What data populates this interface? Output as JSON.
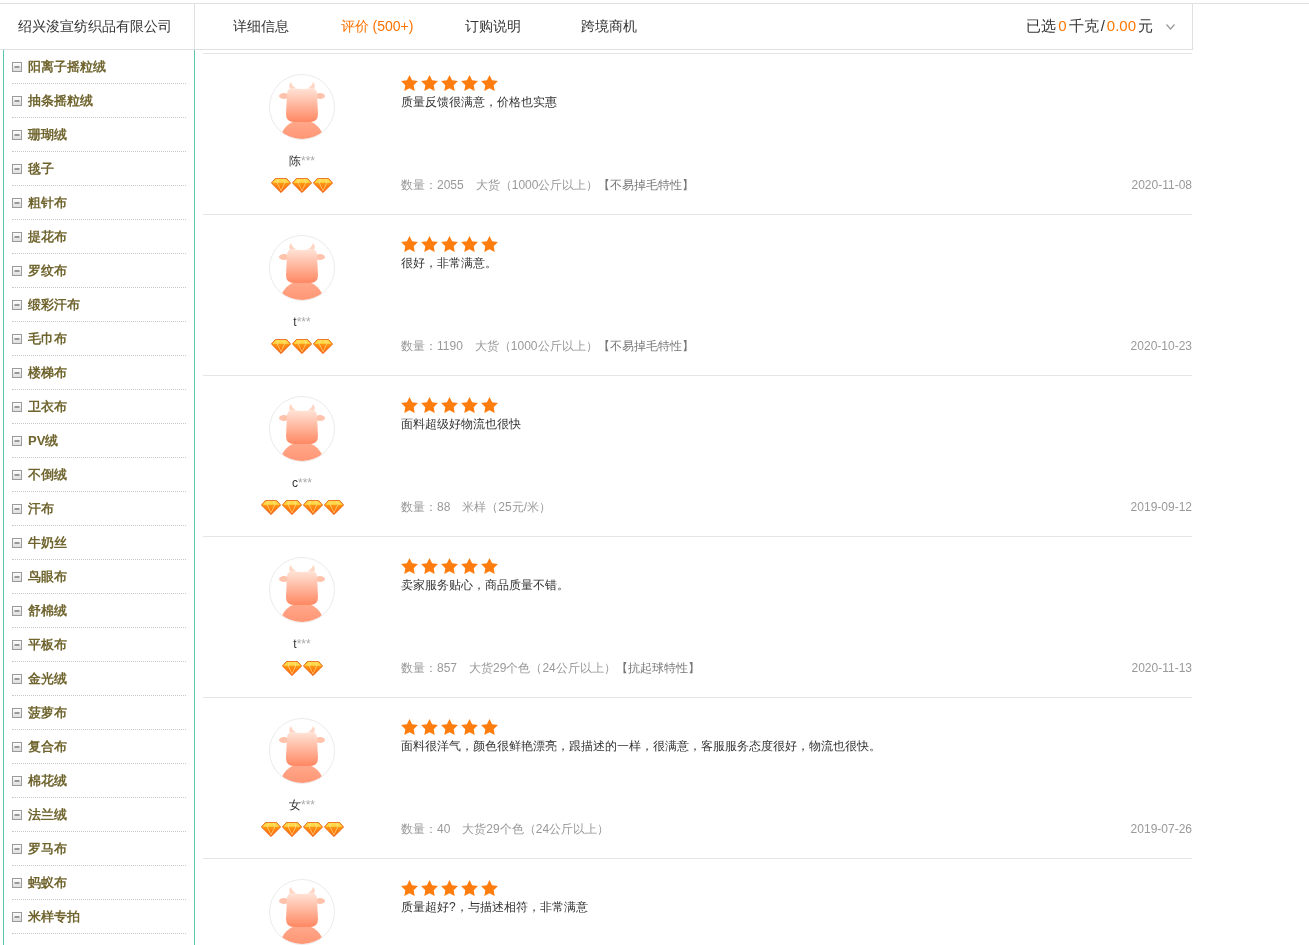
{
  "company_name": "绍兴浚宣纺织品有限公司",
  "tabs": [
    {
      "label": "详细信息",
      "selected": false
    },
    {
      "label": "评价 (500+)",
      "selected": true
    },
    {
      "label": "订购说明",
      "selected": false
    },
    {
      "label": "跨境商机",
      "selected": false
    }
  ],
  "selection_summary": [
    {
      "text": "已选",
      "kind": "label"
    },
    {
      "text": "0",
      "kind": "value"
    },
    {
      "text": "千克",
      "kind": "label"
    },
    {
      "text": "/",
      "kind": "label"
    },
    {
      "text": "0.00",
      "kind": "value"
    },
    {
      "text": "元",
      "kind": "label"
    }
  ],
  "sidebar": {
    "items": [
      {
        "label": "阳离子摇粒绒",
        "expanded": true
      },
      {
        "label": "抽条摇粒绒",
        "expanded": true
      },
      {
        "label": "珊瑚绒",
        "expanded": true
      },
      {
        "label": "毯子",
        "expanded": true
      },
      {
        "label": "粗针布",
        "expanded": true
      },
      {
        "label": "提花布",
        "expanded": true
      },
      {
        "label": "罗纹布",
        "expanded": true
      },
      {
        "label": "缎彩汗布",
        "expanded": true
      },
      {
        "label": "毛巾布",
        "expanded": true
      },
      {
        "label": "楼梯布",
        "expanded": true
      },
      {
        "label": "卫衣布",
        "expanded": true
      },
      {
        "label": "PV绒",
        "expanded": true
      },
      {
        "label": "不倒绒",
        "expanded": true
      },
      {
        "label": "汗布",
        "expanded": true
      },
      {
        "label": "牛奶丝",
        "expanded": true
      },
      {
        "label": "鸟眼布",
        "expanded": true
      },
      {
        "label": "舒棉绒",
        "expanded": true
      },
      {
        "label": "平板布",
        "expanded": true
      },
      {
        "label": "金光绒",
        "expanded": true
      },
      {
        "label": "菠萝布",
        "expanded": true
      },
      {
        "label": "复合布",
        "expanded": true
      },
      {
        "label": "棉花绒",
        "expanded": true
      },
      {
        "label": "法兰绒",
        "expanded": true
      },
      {
        "label": "罗马布",
        "expanded": true
      },
      {
        "label": "蚂蚁布",
        "expanded": true
      },
      {
        "label": "米样专拍",
        "expanded": true
      }
    ]
  },
  "reviews": [
    {
      "reviewer": {
        "name": "陈",
        "name_mask": "***",
        "credit_badges": [
          {
            "kind": "diamond"
          },
          {
            "kind": "diamond"
          },
          {
            "kind": "diamond"
          }
        ]
      },
      "stars": 5,
      "comment": "质量反馈很满意，价格也实惠",
      "quantity": "数量：2055",
      "spec": "大货（1000公斤以上）",
      "feature": "【不易掉毛特性】",
      "date": "2020-11-08"
    },
    {
      "reviewer": {
        "name": "t",
        "name_mask": "***",
        "credit_badges": [
          {
            "kind": "diamond"
          },
          {
            "kind": "diamond"
          },
          {
            "kind": "diamond"
          }
        ]
      },
      "stars": 5,
      "comment": "很好，非常满意。",
      "quantity": "数量：1190",
      "spec": "大货（1000公斤以上）",
      "feature": "【不易掉毛特性】",
      "date": "2020-10-23"
    },
    {
      "reviewer": {
        "name": "c",
        "name_mask": "***",
        "credit_badges": [
          {
            "kind": "diamond"
          },
          {
            "kind": "diamond"
          },
          {
            "kind": "diamond"
          },
          {
            "kind": "diamond"
          }
        ]
      },
      "stars": 5,
      "comment": "面料超级好物流也很快",
      "quantity": "数量：88",
      "spec": "米样（25元/米）",
      "date": "2019-09-12"
    },
    {
      "reviewer": {
        "name": "t",
        "name_mask": "***",
        "credit_badges": [
          {
            "kind": "diamond"
          },
          {
            "kind": "diamond"
          }
        ]
      },
      "stars": 5,
      "comment": "卖家服务贴心，商品质量不错。",
      "quantity": "数量：857",
      "spec": "大货29个色（24公斤以上）",
      "feature": "【抗起球特性】",
      "date": "2020-11-13"
    },
    {
      "reviewer": {
        "name": "女",
        "name_mask": "***",
        "credit_badges": [
          {
            "kind": "diamond"
          },
          {
            "kind": "diamond"
          },
          {
            "kind": "diamond"
          },
          {
            "kind": "diamond"
          }
        ]
      },
      "stars": 5,
      "comment": "面料很洋气，颜色很鲜艳漂亮，跟描述的一样，很满意，客服服务态度很好，物流也很快。",
      "quantity": "数量：40",
      "spec": "大货29个色（24公斤以上）",
      "date": "2019-07-26"
    },
    {
      "stars": 5,
      "comment": "质量超好?，与描述相符，非常满意"
    }
  ]
}
